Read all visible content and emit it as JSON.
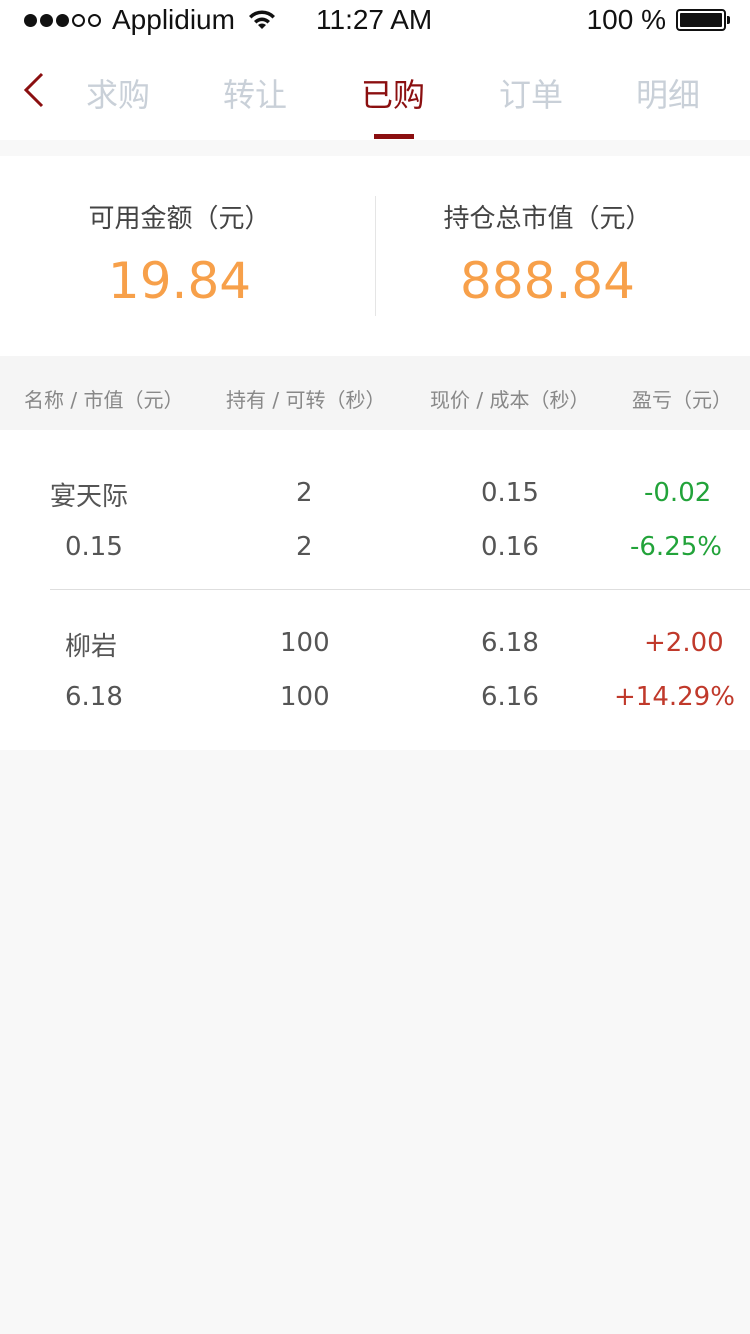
{
  "status_bar": {
    "carrier": "Applidium",
    "time": "11:27 AM",
    "battery": "100 %"
  },
  "nav": {
    "tabs": [
      {
        "label": "求购"
      },
      {
        "label": "转让"
      },
      {
        "label": "已购"
      },
      {
        "label": "订单"
      },
      {
        "label": "明细"
      }
    ],
    "active_tab": "已购"
  },
  "summary": {
    "available": {
      "label": "可用金额（元）",
      "value": "19.84"
    },
    "holding_value": {
      "label": "持仓总市值（元）",
      "value": "888.84"
    }
  },
  "table": {
    "headers": [
      "名称 / 市值（元）",
      "持有 / 可转（秒）",
      "现价 / 成本（秒）",
      "盈亏（元）"
    ],
    "rows": [
      {
        "name": "宴天际",
        "market_value": "0.15",
        "holding": "2",
        "transferable": "2",
        "price": "0.15",
        "cost": "0.16",
        "pnl": "-0.02",
        "pnl_pct": "-6.25%",
        "trend": "down"
      },
      {
        "name": "柳岩",
        "market_value": "6.18",
        "holding": "100",
        "transferable": "100",
        "price": "6.18",
        "cost": "6.16",
        "pnl": "+2.00",
        "pnl_pct": "+14.29%",
        "trend": "up"
      }
    ]
  },
  "colors": {
    "accent": "#8b0f10",
    "value_orange": "#f7a04a",
    "gain_red": "#c0392b",
    "loss_green": "#22a33a"
  },
  "icons": {
    "back": "chevron-left-icon",
    "wifi": "wifi-icon",
    "battery": "battery-icon"
  }
}
